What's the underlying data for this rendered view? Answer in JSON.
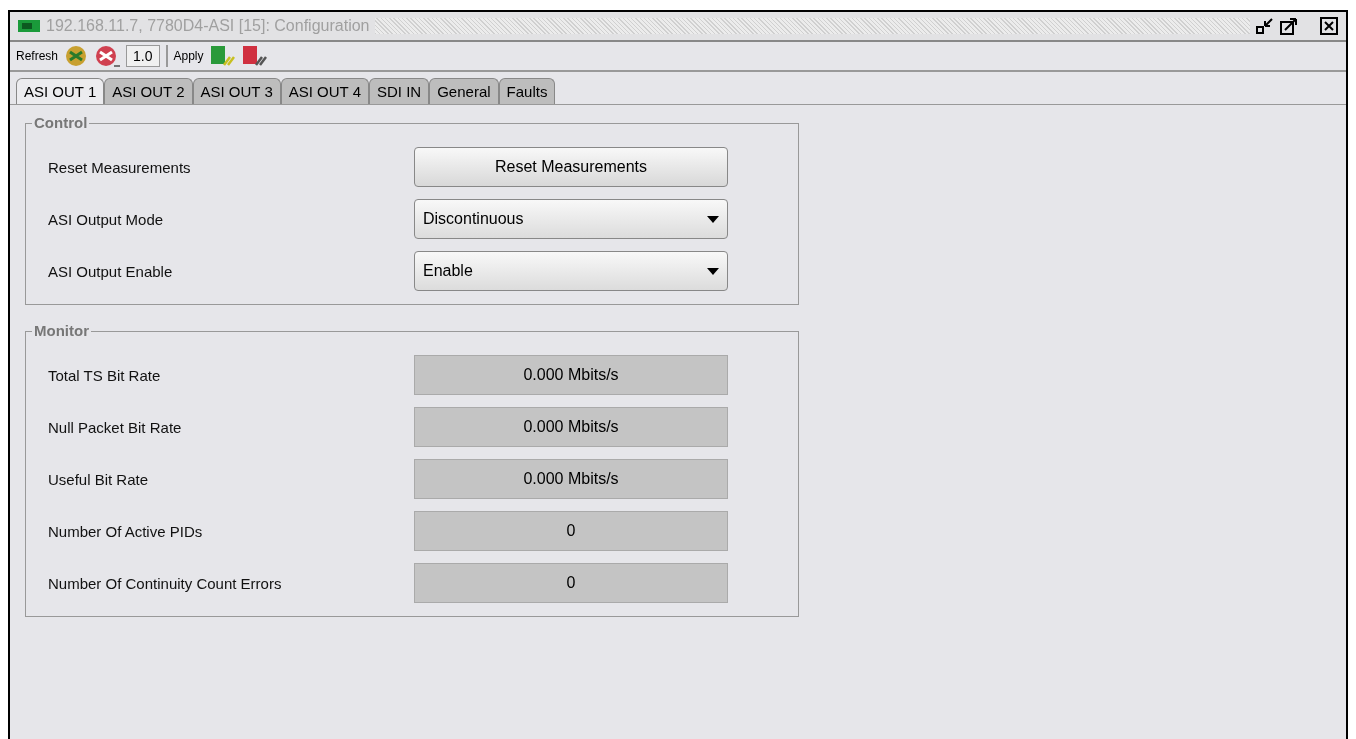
{
  "window": {
    "title": "192.168.11.7, 7780D4-ASI  [15]: Configuration"
  },
  "toolbar": {
    "refresh_label": "Refresh",
    "interval": "1.0",
    "apply_label": "Apply"
  },
  "tabs": [
    {
      "label": "ASI OUT 1",
      "selected": true
    },
    {
      "label": "ASI OUT 2",
      "selected": false
    },
    {
      "label": "ASI OUT 3",
      "selected": false
    },
    {
      "label": "ASI OUT 4",
      "selected": false
    },
    {
      "label": "SDI IN",
      "selected": false
    },
    {
      "label": "General",
      "selected": false
    },
    {
      "label": "Faults",
      "selected": false
    }
  ],
  "groups": [
    {
      "title": "Control",
      "rows": [
        {
          "label": "Reset Measurements",
          "kind": "button",
          "value": "Reset Measurements"
        },
        {
          "label": "ASI Output Mode",
          "kind": "dropdown",
          "value": "Discontinuous"
        },
        {
          "label": "ASI Output Enable",
          "kind": "dropdown",
          "value": "Enable"
        }
      ]
    },
    {
      "title": "Monitor",
      "rows": [
        {
          "label": "Total TS Bit Rate",
          "kind": "readout",
          "value": "0.000 Mbits/s"
        },
        {
          "label": "Null Packet Bit Rate",
          "kind": "readout",
          "value": "0.000 Mbits/s"
        },
        {
          "label": "Useful Bit Rate",
          "kind": "readout",
          "value": "0.000 Mbits/s"
        },
        {
          "label": "Number Of Active PIDs",
          "kind": "readout",
          "value": "0"
        },
        {
          "label": "Number Of Continuity Count Errors",
          "kind": "readout",
          "value": "0"
        }
      ]
    }
  ]
}
